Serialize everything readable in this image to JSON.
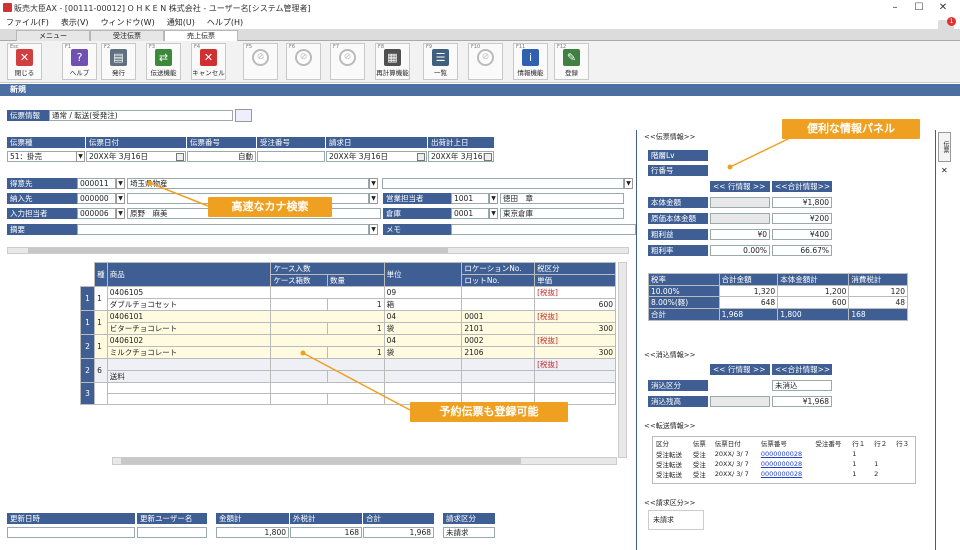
{
  "window": {
    "title": "販売大臣AX - [00111-00012] O H K E N 株式会社 - ユーザー名[システム管理者]",
    "notify_count": "1"
  },
  "menu": [
    "ファイル(F)",
    "表示(V)",
    "ウィンドウ(W)",
    "通知(U)",
    "ヘルプ(H)"
  ],
  "tabs": [
    "メニュー",
    "受注伝票",
    "売上伝票"
  ],
  "toolbar": [
    {
      "key": "Esc",
      "label": "閉じる",
      "icon": "close-icon",
      "color": "#d04040"
    },
    {
      "key": "F1",
      "label": "ヘルプ",
      "icon": "help-icon",
      "color": "#7050b0"
    },
    {
      "key": "F2",
      "label": "発行",
      "icon": "print-icon",
      "color": "#607080"
    },
    {
      "key": "F3",
      "label": "伝送機能",
      "icon": "transfer-icon",
      "color": "#3a8a3a"
    },
    {
      "key": "F4",
      "label": "キャンセル",
      "icon": "cancel-icon",
      "color": "#d03030"
    },
    {
      "key": "F5",
      "label": "",
      "icon": "disabled-icon",
      "color": ""
    },
    {
      "key": "F6",
      "label": "",
      "icon": "disabled-icon",
      "color": ""
    },
    {
      "key": "F7",
      "label": "",
      "icon": "disabled-icon",
      "color": ""
    },
    {
      "key": "F8",
      "label": "再計算機能",
      "icon": "calculator-icon",
      "color": "#505050"
    },
    {
      "key": "F9",
      "label": "一覧",
      "icon": "list-icon",
      "color": "#406080"
    },
    {
      "key": "F10",
      "label": "",
      "icon": "disabled-icon",
      "color": ""
    },
    {
      "key": "F11",
      "label": "情報機能",
      "icon": "info-icon",
      "color": "#3060b0"
    },
    {
      "key": "F12",
      "label": "登録",
      "icon": "register-icon",
      "color": "#408040"
    }
  ],
  "mode_header": "新規",
  "slip_info": {
    "label": "伝票情報",
    "value": "通常 / 転送(受発注)"
  },
  "header_fields": {
    "slip_type_label": "伝票種",
    "slip_type_value": "51：掛売",
    "slip_date_label": "伝票日付",
    "slip_date_value": "20XX年 3月16日",
    "slip_no_label": "伝票番号",
    "slip_no_value": "自動",
    "order_no_label": "受注番号",
    "order_no_value": "",
    "bill_date_label": "請求日",
    "bill_date_value": "20XX年 3月16日",
    "ship_date_label": "出荷計上日",
    "ship_date_value": "20XX年 3月16日"
  },
  "party_fields": {
    "customer_label": "得意先",
    "customer_code": "000011",
    "customer_name": "埼玉県物産",
    "delivery_label": "納入先",
    "delivery_code": "000000",
    "entry_label": "入力担当者",
    "entry_code": "000006",
    "entry_name": "原野　麻美",
    "memo_label": "摘要",
    "sales_rep_label": "営業担当者",
    "sales_rep_code": "1001",
    "sales_rep_name": "徳田　章",
    "warehouse_label": "倉庫",
    "warehouse_code": "0001",
    "warehouse_name": "東京倉庫",
    "note_label": "メモ"
  },
  "callouts": {
    "kana": "高速なカナ検索",
    "reserve": "予約伝票も登録可能",
    "panel": "便利な情報パネル"
  },
  "grid": {
    "headers": {
      "kind": "種",
      "product": "商品",
      "case_qty": "ケース入数",
      "case_count": "ケース箱数",
      "qty": "数量",
      "unit": "単位",
      "location": "ロケーションNo.",
      "lot": "ロットNo.",
      "tax": "税区分",
      "price": "単価"
    },
    "rows": [
      {
        "num": "1",
        "kind": "1",
        "code": "0406105",
        "name": "ダブルチョコセット",
        "qty": "1",
        "unit_code": "09",
        "unit": "箱",
        "location": "",
        "lot": "",
        "tax": "[税抜]",
        "price": "600",
        "style": "white"
      },
      {
        "num": "1",
        "kind": "1",
        "code": "0406101",
        "name": "ビターチョコレート",
        "qty": "1",
        "unit_code": "04",
        "unit": "袋",
        "location": "0001",
        "lot": "2101",
        "tax": "[税抜]",
        "price": "300",
        "style": "yellow"
      },
      {
        "num": "2",
        "kind": "1",
        "code": "0406102",
        "name": "ミルクチョコレート",
        "qty": "1",
        "unit_code": "04",
        "unit": "袋",
        "location": "0002",
        "lot": "2106",
        "tax": "[税抜]",
        "price": "300",
        "style": "yellow"
      },
      {
        "num": "2",
        "kind": "6",
        "code": "",
        "name": "送料",
        "qty": "",
        "unit_code": "",
        "unit": "",
        "location": "",
        "lot": "",
        "tax": "[税抜]",
        "price": "",
        "style": "white"
      },
      {
        "num": "3",
        "kind": "",
        "code": "",
        "name": "",
        "qty": "",
        "unit_code": "",
        "unit": "",
        "location": "",
        "lot": "",
        "tax": "",
        "price": "",
        "style": "white"
      }
    ]
  },
  "footer": {
    "updated_label": "更新日時",
    "updated_value": "",
    "user_label": "更新ユーザー名",
    "user_value": "",
    "amount_label": "金額計",
    "amount_value": "1,800",
    "tax_label": "外税計",
    "tax_value": "168",
    "total_label": "合計",
    "total_value": "1,968",
    "bill_label": "請求区分",
    "bill_value": "未請求"
  },
  "panel": {
    "slip_section": "<<伝票情報>>",
    "layer_label": "階層Lv",
    "line_label": "行番号",
    "line_info_btn": "<< 行情報 >>",
    "total_info_btn": "<<合計情報>>",
    "rows": [
      {
        "label": "本体金額",
        "line": "",
        "total": "¥1,800"
      },
      {
        "label": "原価本体金額",
        "line": "",
        "total": "¥200"
      },
      {
        "label": "粗利益",
        "line": "¥0",
        "total": "¥400"
      },
      {
        "label": "粗利率",
        "line": "0.00%",
        "total": "66.67%"
      }
    ],
    "tax_headers": [
      "税率",
      "合計金額",
      "本体金額計",
      "消費税計"
    ],
    "tax_rows": [
      [
        "10.00%",
        "1,320",
        "1,200",
        "120"
      ],
      [
        "8.00%(軽)",
        "648",
        "600",
        "48"
      ],
      [
        "合計",
        "1,968",
        "1,800",
        "168"
      ]
    ],
    "consume_section": "<<消込情報>>",
    "consume_line_btn": "<< 行情報 >>",
    "consume_total_btn": "<<合計情報>>",
    "consume_kind_label": "消込区分",
    "consume_kind_value": "未消込",
    "consume_remain_label": "消込残高",
    "consume_remain_value": "¥1,968",
    "transfer_section": "<<転送情報>>",
    "transfer_headers": [
      "区分",
      "伝票",
      "伝票日付",
      "伝票番号",
      "受注番号",
      "行１",
      "行２",
      "行３"
    ],
    "transfer_rows": [
      [
        "受注転送",
        "受注",
        "20XX/ 3/ 7",
        "0000000028",
        "",
        "1",
        "",
        ""
      ],
      [
        "受注転送",
        "受注",
        "20XX/ 3/ 7",
        "0000000028",
        "",
        "1",
        "1",
        ""
      ],
      [
        "受注転送",
        "受注",
        "20XX/ 3/ 7",
        "0000000028",
        "",
        "1",
        "2",
        ""
      ]
    ],
    "bill_section": "<<請求区分>>",
    "bill_value": "未請求",
    "side_tab": "伝票"
  }
}
